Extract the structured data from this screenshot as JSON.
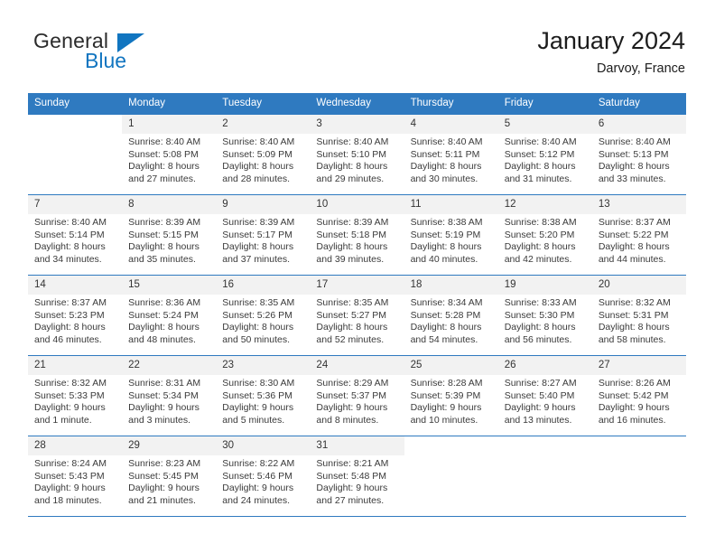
{
  "brand": {
    "name_part1": "General",
    "name_part2": "Blue",
    "accent_color": "#1175c0"
  },
  "header": {
    "title": "January 2024",
    "subtitle": "Darvoy, France"
  },
  "theme": {
    "header_row_color": "#2f7ac0",
    "daynum_bg": "#f2f2f2",
    "text_color": "#3a3a3a"
  },
  "calendar": {
    "weekday_headers": [
      "Sunday",
      "Monday",
      "Tuesday",
      "Wednesday",
      "Thursday",
      "Friday",
      "Saturday"
    ],
    "weeks": [
      [
        {
          "day": "",
          "sunrise": "",
          "sunset": "",
          "daylight1": "",
          "daylight2": ""
        },
        {
          "day": "1",
          "sunrise": "Sunrise: 8:40 AM",
          "sunset": "Sunset: 5:08 PM",
          "daylight1": "Daylight: 8 hours",
          "daylight2": "and 27 minutes."
        },
        {
          "day": "2",
          "sunrise": "Sunrise: 8:40 AM",
          "sunset": "Sunset: 5:09 PM",
          "daylight1": "Daylight: 8 hours",
          "daylight2": "and 28 minutes."
        },
        {
          "day": "3",
          "sunrise": "Sunrise: 8:40 AM",
          "sunset": "Sunset: 5:10 PM",
          "daylight1": "Daylight: 8 hours",
          "daylight2": "and 29 minutes."
        },
        {
          "day": "4",
          "sunrise": "Sunrise: 8:40 AM",
          "sunset": "Sunset: 5:11 PM",
          "daylight1": "Daylight: 8 hours",
          "daylight2": "and 30 minutes."
        },
        {
          "day": "5",
          "sunrise": "Sunrise: 8:40 AM",
          "sunset": "Sunset: 5:12 PM",
          "daylight1": "Daylight: 8 hours",
          "daylight2": "and 31 minutes."
        },
        {
          "day": "6",
          "sunrise": "Sunrise: 8:40 AM",
          "sunset": "Sunset: 5:13 PM",
          "daylight1": "Daylight: 8 hours",
          "daylight2": "and 33 minutes."
        }
      ],
      [
        {
          "day": "7",
          "sunrise": "Sunrise: 8:40 AM",
          "sunset": "Sunset: 5:14 PM",
          "daylight1": "Daylight: 8 hours",
          "daylight2": "and 34 minutes."
        },
        {
          "day": "8",
          "sunrise": "Sunrise: 8:39 AM",
          "sunset": "Sunset: 5:15 PM",
          "daylight1": "Daylight: 8 hours",
          "daylight2": "and 35 minutes."
        },
        {
          "day": "9",
          "sunrise": "Sunrise: 8:39 AM",
          "sunset": "Sunset: 5:17 PM",
          "daylight1": "Daylight: 8 hours",
          "daylight2": "and 37 minutes."
        },
        {
          "day": "10",
          "sunrise": "Sunrise: 8:39 AM",
          "sunset": "Sunset: 5:18 PM",
          "daylight1": "Daylight: 8 hours",
          "daylight2": "and 39 minutes."
        },
        {
          "day": "11",
          "sunrise": "Sunrise: 8:38 AM",
          "sunset": "Sunset: 5:19 PM",
          "daylight1": "Daylight: 8 hours",
          "daylight2": "and 40 minutes."
        },
        {
          "day": "12",
          "sunrise": "Sunrise: 8:38 AM",
          "sunset": "Sunset: 5:20 PM",
          "daylight1": "Daylight: 8 hours",
          "daylight2": "and 42 minutes."
        },
        {
          "day": "13",
          "sunrise": "Sunrise: 8:37 AM",
          "sunset": "Sunset: 5:22 PM",
          "daylight1": "Daylight: 8 hours",
          "daylight2": "and 44 minutes."
        }
      ],
      [
        {
          "day": "14",
          "sunrise": "Sunrise: 8:37 AM",
          "sunset": "Sunset: 5:23 PM",
          "daylight1": "Daylight: 8 hours",
          "daylight2": "and 46 minutes."
        },
        {
          "day": "15",
          "sunrise": "Sunrise: 8:36 AM",
          "sunset": "Sunset: 5:24 PM",
          "daylight1": "Daylight: 8 hours",
          "daylight2": "and 48 minutes."
        },
        {
          "day": "16",
          "sunrise": "Sunrise: 8:35 AM",
          "sunset": "Sunset: 5:26 PM",
          "daylight1": "Daylight: 8 hours",
          "daylight2": "and 50 minutes."
        },
        {
          "day": "17",
          "sunrise": "Sunrise: 8:35 AM",
          "sunset": "Sunset: 5:27 PM",
          "daylight1": "Daylight: 8 hours",
          "daylight2": "and 52 minutes."
        },
        {
          "day": "18",
          "sunrise": "Sunrise: 8:34 AM",
          "sunset": "Sunset: 5:28 PM",
          "daylight1": "Daylight: 8 hours",
          "daylight2": "and 54 minutes."
        },
        {
          "day": "19",
          "sunrise": "Sunrise: 8:33 AM",
          "sunset": "Sunset: 5:30 PM",
          "daylight1": "Daylight: 8 hours",
          "daylight2": "and 56 minutes."
        },
        {
          "day": "20",
          "sunrise": "Sunrise: 8:32 AM",
          "sunset": "Sunset: 5:31 PM",
          "daylight1": "Daylight: 8 hours",
          "daylight2": "and 58 minutes."
        }
      ],
      [
        {
          "day": "21",
          "sunrise": "Sunrise: 8:32 AM",
          "sunset": "Sunset: 5:33 PM",
          "daylight1": "Daylight: 9 hours",
          "daylight2": "and 1 minute."
        },
        {
          "day": "22",
          "sunrise": "Sunrise: 8:31 AM",
          "sunset": "Sunset: 5:34 PM",
          "daylight1": "Daylight: 9 hours",
          "daylight2": "and 3 minutes."
        },
        {
          "day": "23",
          "sunrise": "Sunrise: 8:30 AM",
          "sunset": "Sunset: 5:36 PM",
          "daylight1": "Daylight: 9 hours",
          "daylight2": "and 5 minutes."
        },
        {
          "day": "24",
          "sunrise": "Sunrise: 8:29 AM",
          "sunset": "Sunset: 5:37 PM",
          "daylight1": "Daylight: 9 hours",
          "daylight2": "and 8 minutes."
        },
        {
          "day": "25",
          "sunrise": "Sunrise: 8:28 AM",
          "sunset": "Sunset: 5:39 PM",
          "daylight1": "Daylight: 9 hours",
          "daylight2": "and 10 minutes."
        },
        {
          "day": "26",
          "sunrise": "Sunrise: 8:27 AM",
          "sunset": "Sunset: 5:40 PM",
          "daylight1": "Daylight: 9 hours",
          "daylight2": "and 13 minutes."
        },
        {
          "day": "27",
          "sunrise": "Sunrise: 8:26 AM",
          "sunset": "Sunset: 5:42 PM",
          "daylight1": "Daylight: 9 hours",
          "daylight2": "and 16 minutes."
        }
      ],
      [
        {
          "day": "28",
          "sunrise": "Sunrise: 8:24 AM",
          "sunset": "Sunset: 5:43 PM",
          "daylight1": "Daylight: 9 hours",
          "daylight2": "and 18 minutes."
        },
        {
          "day": "29",
          "sunrise": "Sunrise: 8:23 AM",
          "sunset": "Sunset: 5:45 PM",
          "daylight1": "Daylight: 9 hours",
          "daylight2": "and 21 minutes."
        },
        {
          "day": "30",
          "sunrise": "Sunrise: 8:22 AM",
          "sunset": "Sunset: 5:46 PM",
          "daylight1": "Daylight: 9 hours",
          "daylight2": "and 24 minutes."
        },
        {
          "day": "31",
          "sunrise": "Sunrise: 8:21 AM",
          "sunset": "Sunset: 5:48 PM",
          "daylight1": "Daylight: 9 hours",
          "daylight2": "and 27 minutes."
        },
        {
          "day": "",
          "sunrise": "",
          "sunset": "",
          "daylight1": "",
          "daylight2": ""
        },
        {
          "day": "",
          "sunrise": "",
          "sunset": "",
          "daylight1": "",
          "daylight2": ""
        },
        {
          "day": "",
          "sunrise": "",
          "sunset": "",
          "daylight1": "",
          "daylight2": ""
        }
      ]
    ]
  }
}
